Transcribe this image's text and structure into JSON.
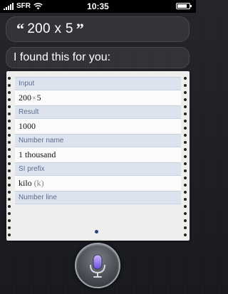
{
  "status_bar": {
    "carrier": "SFR",
    "time": "10:35",
    "signal_bars": 5,
    "battery_level": 0.8,
    "icons": [
      "signal-icon",
      "wifi-icon",
      "battery-icon"
    ]
  },
  "query": {
    "open_quote": "“",
    "text": "200 x 5",
    "close_quote": "”"
  },
  "reply": {
    "text": "I found this for you:"
  },
  "pods": [
    {
      "header": "Input",
      "value_a": "200",
      "value_op": "×",
      "value_b": "5"
    },
    {
      "header": "Result",
      "value": "1000"
    },
    {
      "header": "Number name",
      "value": "1 thousand"
    },
    {
      "header": "SI prefix",
      "value": "kilo",
      "value_secondary": "(k)"
    },
    {
      "header": "Number line"
    }
  ],
  "colors": {
    "pod_header_bg": "#dce3ef",
    "pod_header_text": "#5d6f8a",
    "mic_accent": "#9b7bff"
  },
  "mic": {
    "icon": "microphone-icon"
  }
}
